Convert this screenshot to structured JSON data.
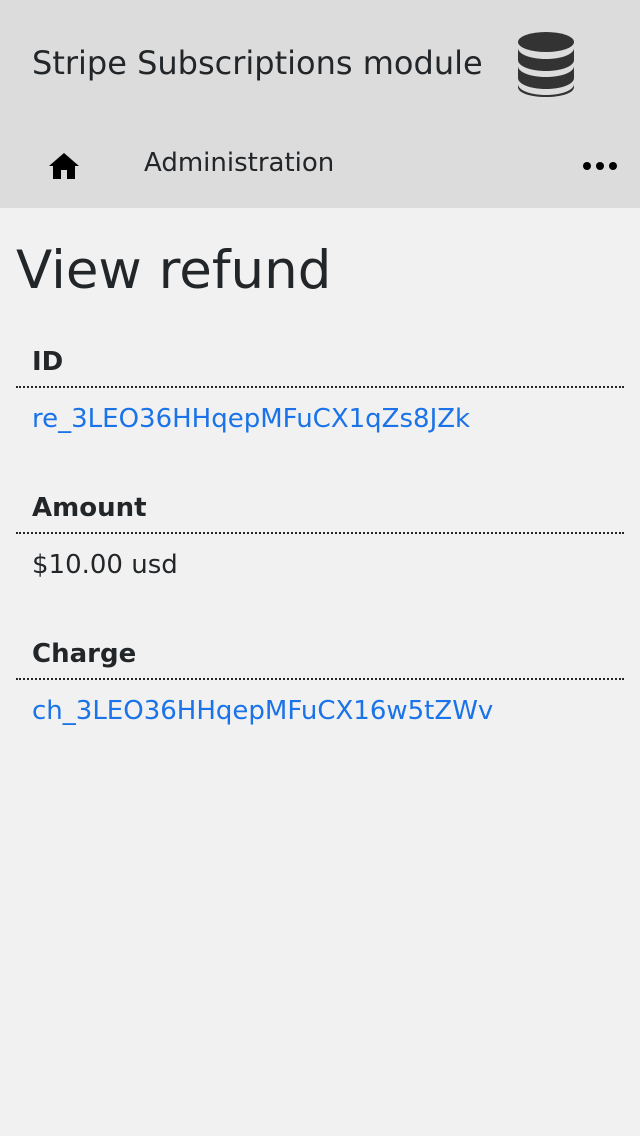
{
  "header": {
    "site_title": "Stripe Subscriptions module",
    "logo_icon": "database-icon"
  },
  "nav": {
    "home_icon": "home-icon",
    "administration_label": "Administration",
    "more_icon": "more-horizontal-icon"
  },
  "page": {
    "title": "View refund"
  },
  "fields": {
    "id": {
      "label": "ID",
      "value": "re_3LEO36HHqepMFuCX1qZs8JZk"
    },
    "amount": {
      "label": "Amount",
      "value": "$10.00 usd"
    },
    "charge": {
      "label": "Charge",
      "value": "ch_3LEO36HHqepMFuCX16w5tZWv"
    }
  },
  "colors": {
    "header_bg": "#dcdcdc",
    "page_bg": "#f1f1f1",
    "text": "#232629",
    "link": "#1a73e8"
  }
}
